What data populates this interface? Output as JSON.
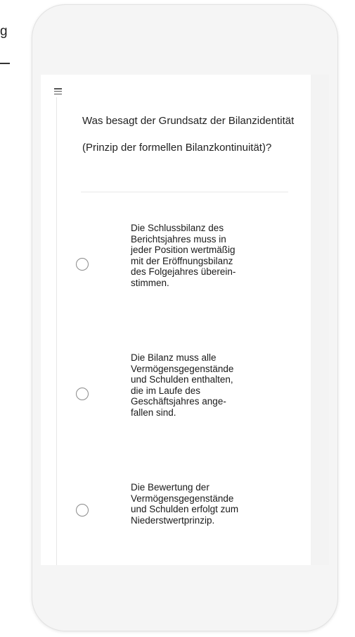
{
  "edge": {
    "text": "g"
  },
  "quiz": {
    "question": "Was besagt der Grundsatz der Bilanzidentität (Prinzip der formellen Bilanzkontinuität)?",
    "options": [
      {
        "label": "Die Schlussbilanz des\nBerichtsjahres muss in\njeder Position wertmäßig\nmit der Eröffnungsbilanz\ndes Folgejahres überein-\nstimmen.",
        "selected": false
      },
      {
        "label": "Die Bilanz muss alle\nVermögensgegenstände\nund Schulden enthalten,\ndie im Laufe des\nGeschäftsjahres ange-\nfallen sind.",
        "selected": false
      },
      {
        "label": "Die Bewertung der\nVermögensgegenstände\nund Schulden erfolgt zum\nNiederstwertprinzip.",
        "selected": false
      }
    ]
  },
  "icons": {
    "menu": "hamburger-menu-icon",
    "radio": "radio-button-icon"
  },
  "colors": {
    "text": "#222222",
    "radio_border": "#8a8a8a",
    "device_bg": "#f5f5f5"
  }
}
